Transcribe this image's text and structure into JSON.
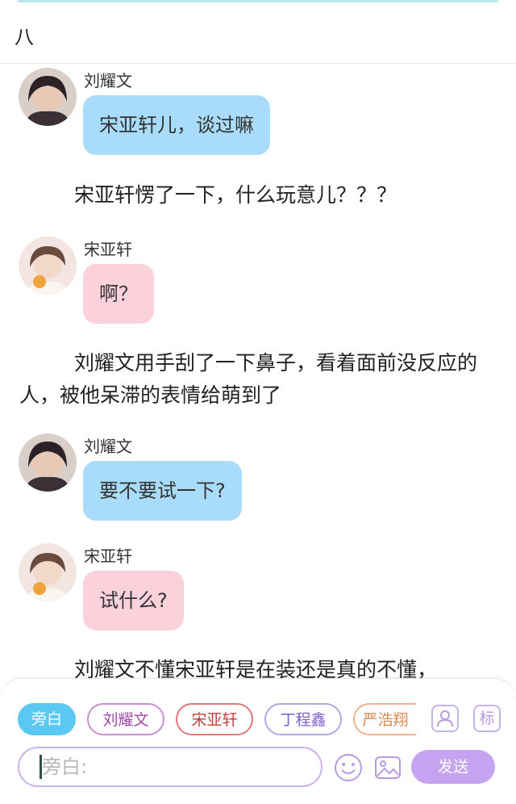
{
  "chapter": {
    "title": "八"
  },
  "messages": [
    {
      "speaker": "刘耀文",
      "text": "宋亚轩儿，谈过嘛"
    },
    {
      "speaker": "宋亚轩",
      "text": "啊？"
    },
    {
      "speaker": "刘耀文",
      "text": "要不要试一下?"
    },
    {
      "speaker": "宋亚轩",
      "text": "试什么?"
    }
  ],
  "narrations": [
    "宋亚轩愣了一下，什么玩意儿？？？",
    "刘耀文用手刮了一下鼻子，看着面前没反应的人，被他呆滞的表情给萌到了",
    "刘耀文不懂宋亚轩是在装还是真的不懂，"
  ],
  "composer": {
    "roles": [
      "旁白",
      "刘耀文",
      "宋亚轩",
      "丁程鑫",
      "严浩翔"
    ],
    "selected_role": "旁白",
    "placeholder": "旁白:",
    "send_label": "发送",
    "mark_label": "标",
    "icons": [
      "user-profile-icon",
      "mark-icon",
      "emoji-icon",
      "image-icon"
    ]
  },
  "colors": {
    "blue_bubble": "#a8dcfa",
    "pink_bubble": "#fbd1dc",
    "accent_purple": "#c4a3f0",
    "selected_chip": "#5ac8f2"
  }
}
